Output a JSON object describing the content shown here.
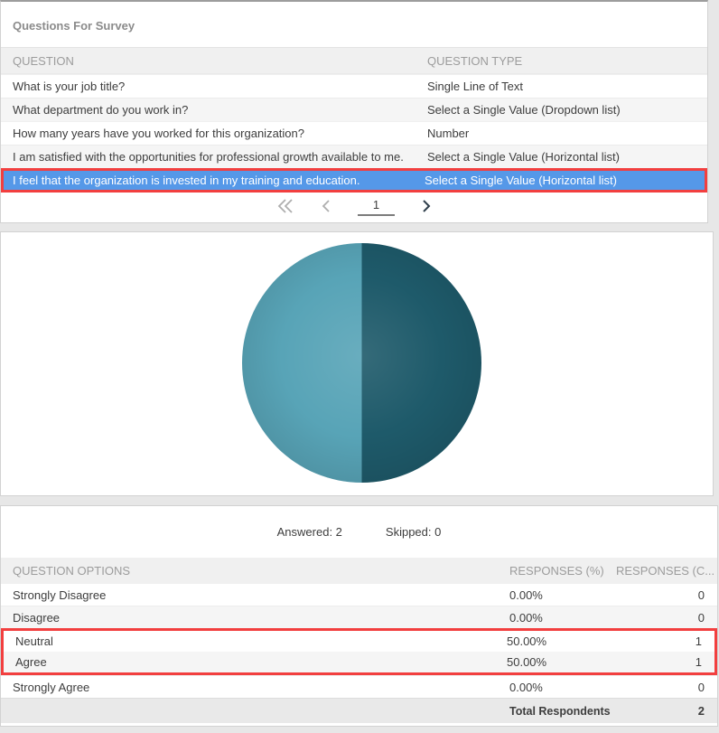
{
  "colors": {
    "selected_row_bg": "#5598e8",
    "highlight_border": "#f23f3f",
    "pie_dark": "#1e5a6a",
    "pie_light": "#58a4b7"
  },
  "icons": {
    "first_page": "double-chevron-left",
    "prev_page": "chevron-left",
    "next_page": "chevron-right"
  },
  "questions_panel": {
    "title": "Questions For Survey",
    "columns": {
      "question": "QUESTION",
      "type": "QUESTION TYPE"
    },
    "rows": [
      {
        "question": "What is your job title?",
        "type": "Single Line of Text",
        "selected": false
      },
      {
        "question": "What department do you work in?",
        "type": "Select a Single Value (Dropdown list)",
        "selected": false
      },
      {
        "question": "How many years have you worked for this organization?",
        "type": "Number",
        "selected": false
      },
      {
        "question": "I am satisfied with the opportunities for professional growth available to me.",
        "type": "Select a Single Value (Horizontal list)",
        "selected": false
      },
      {
        "question": "I feel that the organization is invested in my training and education.",
        "type": "Select a Single Value (Horizontal list)",
        "selected": true
      }
    ],
    "pagination": {
      "page": "1"
    }
  },
  "chart_data": {
    "type": "pie",
    "title": "",
    "categories": [
      "Strongly Disagree",
      "Disagree",
      "Neutral",
      "Agree",
      "Strongly Agree"
    ],
    "values": [
      0,
      0,
      50,
      50,
      0
    ],
    "slices": [
      {
        "label": "Neutral",
        "value": 50,
        "color": "#1e5a6a"
      },
      {
        "label": "Agree",
        "value": 50,
        "color": "#58a4b7"
      }
    ],
    "start_angle_deg": 0,
    "direction": "clockwise",
    "legend": "none",
    "data_labels": "none"
  },
  "stats": {
    "answered": "Answered: 2",
    "skipped": "Skipped: 0"
  },
  "results_table": {
    "columns": {
      "options": "QUESTION OPTIONS",
      "responses_pct": "RESPONSES (%)",
      "responses_count": "RESPONSES (C..."
    },
    "rows": [
      {
        "option": "Strongly Disagree",
        "pct": "0.00%",
        "count": "0",
        "highlighted": false
      },
      {
        "option": "Disagree",
        "pct": "0.00%",
        "count": "0",
        "highlighted": false
      },
      {
        "option": "Neutral",
        "pct": "50.00%",
        "count": "1",
        "highlighted": true
      },
      {
        "option": "Agree",
        "pct": "50.00%",
        "count": "1",
        "highlighted": true
      },
      {
        "option": "Strongly Agree",
        "pct": "0.00%",
        "count": "0",
        "highlighted": false
      }
    ],
    "total": {
      "label": "Total Respondents",
      "value": "2"
    }
  }
}
